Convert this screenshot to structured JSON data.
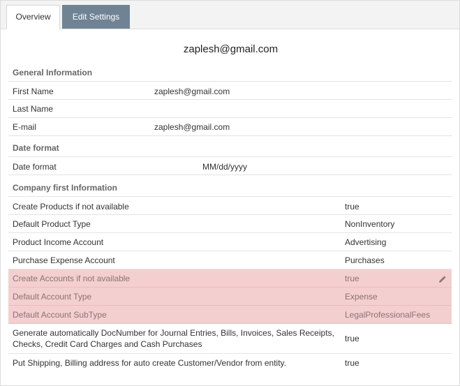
{
  "tabs": {
    "overview": "Overview",
    "edit_settings": "Edit Settings"
  },
  "title": "zaplesh@gmail.com",
  "general": {
    "heading": "General Information",
    "rows": [
      {
        "label": "First Name",
        "value": "zaplesh@gmail.com"
      },
      {
        "label": "Last Name",
        "value": ""
      },
      {
        "label": "E-mail",
        "value": "zaplesh@gmail.com"
      }
    ]
  },
  "date_format": {
    "heading": "Date format",
    "rows": [
      {
        "label": "Date format",
        "value": "MM/dd/yyyy"
      }
    ]
  },
  "company": {
    "heading": "Company first Information",
    "rows": [
      {
        "label": "Create Products if not available",
        "value": "true"
      },
      {
        "label": "Default Product Type",
        "value": "NonInventory"
      },
      {
        "label": "Product Income Account",
        "value": "Advertising"
      },
      {
        "label": "Purchase Expense Account",
        "value": "Purchases"
      },
      {
        "label": "Create Accounts if not available",
        "value": "true"
      },
      {
        "label": "Default Account Type",
        "value": "Expense"
      },
      {
        "label": "Default Account SubType",
        "value": "LegalProfessionalFees"
      },
      {
        "label_line1": "Generate automatically DocNumber for Journal Entries, Bills, Invoices, Sales Receipts,",
        "label_line2": "Checks, Credit Card Charges and Cash Purchases",
        "value": "true"
      },
      {
        "label": "Put Shipping, Billing address for auto create Customer/Vendor from entity.",
        "value": "true"
      }
    ]
  },
  "colors": {
    "highlight": "#f4cfcf",
    "tab_active": "#6f8394"
  },
  "icons": {
    "edit": "pencil-icon"
  }
}
